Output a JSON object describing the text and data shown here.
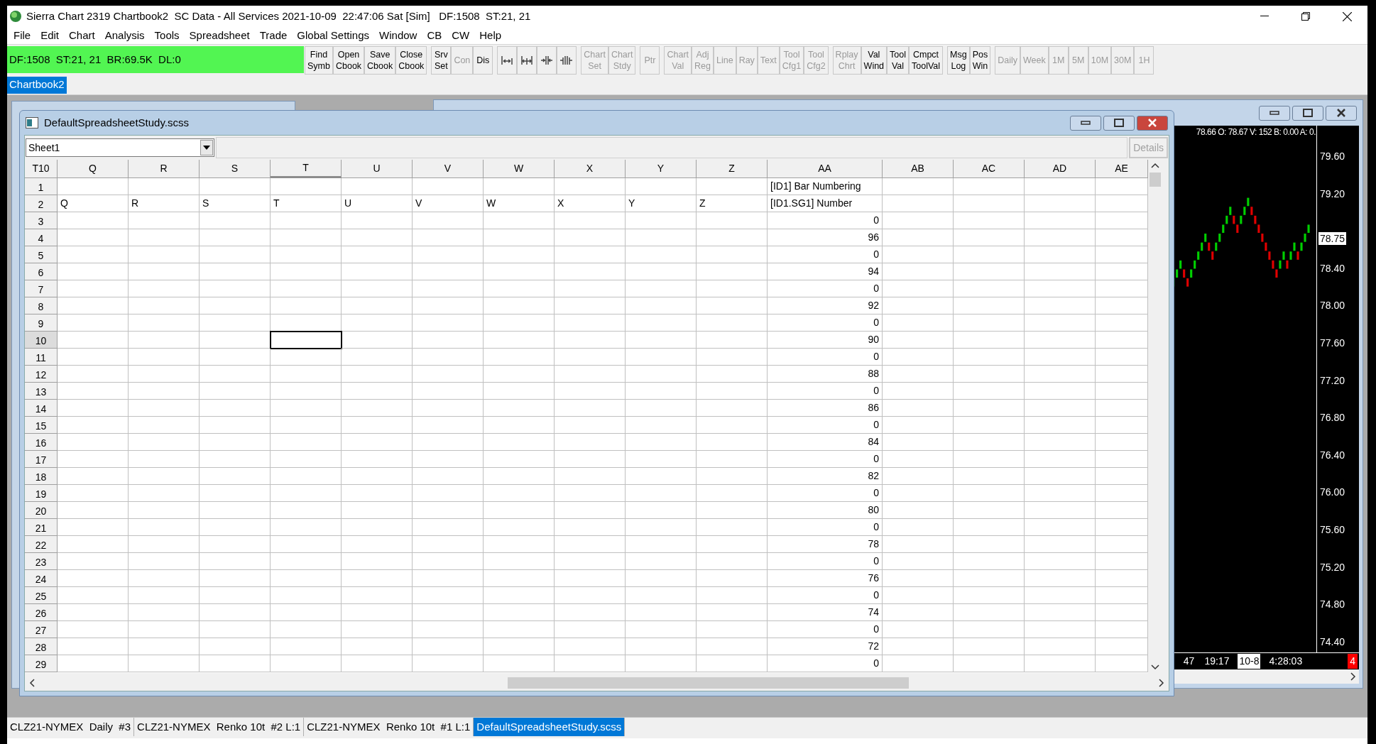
{
  "window": {
    "title": "Sierra Chart 2319 Chartbook2  SC Data - All Services 2021-10-09  22:47:06 Sat [Sim]   DF:1508  ST:21, 21"
  },
  "menu": [
    "File",
    "Edit",
    "Chart",
    "Analysis",
    "Tools",
    "Spreadsheet",
    "Trade",
    "Global Settings",
    "Window",
    "CB",
    "CW",
    "Help"
  ],
  "status_panel": "DF:1508  ST:21, 21  BR:69.5K  DL:0",
  "toolbar": [
    [
      {
        "kind": "text",
        "lines": [
          "Find",
          "Symb"
        ],
        "disabled": false
      },
      {
        "kind": "text",
        "lines": [
          "Open",
          "Cbook"
        ],
        "disabled": false
      },
      {
        "kind": "text",
        "lines": [
          "Save",
          "Cbook"
        ],
        "disabled": false
      },
      {
        "kind": "text",
        "lines": [
          "Close",
          "Cbook"
        ],
        "disabled": false
      }
    ],
    [
      {
        "kind": "text",
        "lines": [
          "Srv",
          "Set"
        ],
        "disabled": false
      },
      {
        "kind": "text",
        "lines": [
          "Con"
        ],
        "disabled": true
      },
      {
        "kind": "text",
        "lines": [
          "Dis"
        ],
        "disabled": false
      }
    ],
    [
      {
        "kind": "expand",
        "disabled": false
      },
      {
        "kind": "expandboth",
        "disabled": false
      },
      {
        "kind": "compress",
        "disabled": false
      },
      {
        "kind": "compressboth",
        "disabled": false
      }
    ],
    [
      {
        "kind": "text",
        "lines": [
          "Chart",
          "Set"
        ],
        "disabled": true
      },
      {
        "kind": "text",
        "lines": [
          "Chart",
          "Stdy"
        ],
        "disabled": true
      }
    ],
    [
      {
        "kind": "text",
        "lines": [
          "Ptr"
        ],
        "disabled": true
      }
    ],
    [
      {
        "kind": "text",
        "lines": [
          "Chart",
          "Val"
        ],
        "disabled": true
      },
      {
        "kind": "text",
        "lines": [
          "Adj",
          "Reg"
        ],
        "disabled": true
      },
      {
        "kind": "text",
        "lines": [
          "Line"
        ],
        "disabled": true
      },
      {
        "kind": "text",
        "lines": [
          "Ray"
        ],
        "disabled": true
      },
      {
        "kind": "text",
        "lines": [
          "Text"
        ],
        "disabled": true
      },
      {
        "kind": "text",
        "lines": [
          "Tool",
          "Cfg1"
        ],
        "disabled": true
      },
      {
        "kind": "text",
        "lines": [
          "Tool",
          "Cfg2"
        ],
        "disabled": true
      }
    ],
    [
      {
        "kind": "text",
        "lines": [
          "Rplay",
          "Chrt"
        ],
        "disabled": true
      },
      {
        "kind": "text",
        "lines": [
          "Val",
          "Wind"
        ],
        "disabled": false
      },
      {
        "kind": "text",
        "lines": [
          "Tool",
          "Val"
        ],
        "disabled": false
      },
      {
        "kind": "text",
        "lines": [
          "Cmpct",
          "ToolVal"
        ],
        "disabled": false
      }
    ],
    [
      {
        "kind": "text",
        "lines": [
          "Msg",
          "Log"
        ],
        "disabled": false
      },
      {
        "kind": "text",
        "lines": [
          "Pos",
          "Win"
        ],
        "disabled": false
      }
    ],
    [
      {
        "kind": "text",
        "lines": [
          "Daily"
        ],
        "disabled": true
      },
      {
        "kind": "text",
        "lines": [
          "Week"
        ],
        "disabled": true
      },
      {
        "kind": "text",
        "lines": [
          "1M"
        ],
        "disabled": true
      },
      {
        "kind": "text",
        "lines": [
          "5M"
        ],
        "disabled": true
      },
      {
        "kind": "text",
        "lines": [
          "10M"
        ],
        "disabled": true
      },
      {
        "kind": "text",
        "lines": [
          "30M"
        ],
        "disabled": true
      },
      {
        "kind": "text",
        "lines": [
          "1H"
        ],
        "disabled": true
      }
    ]
  ],
  "chartbook_tabs": [
    {
      "label": "Chartbook2",
      "selected": true
    }
  ],
  "chart_window": {
    "info": "78.66 O: 78.67 V: 152 B: 0.00 A: 0.",
    "price_axis": [
      "79.60",
      "79.20",
      "78.40",
      "78.00",
      "77.60",
      "77.20",
      "76.80",
      "76.40",
      "76.00",
      "75.60",
      "75.20",
      "74.80",
      "74.40"
    ],
    "current_price": "78.75",
    "time_axis": [
      {
        "label": "47",
        "kind": "plain"
      },
      {
        "label": "19:17",
        "kind": "plain"
      },
      {
        "label": "10-8",
        "kind": "highlight"
      },
      {
        "label": "4:28:03",
        "kind": "plain"
      }
    ],
    "badge": "4"
  },
  "spreadsheet": {
    "title": "DefaultSpreadsheetStudy.scss",
    "sheet": "Sheet1",
    "details_button": {
      "label": "Details",
      "disabled": true
    },
    "name_box": "T10",
    "columns": [
      {
        "label": "Q",
        "selected": false
      },
      {
        "label": "R",
        "selected": false
      },
      {
        "label": "S",
        "selected": false
      },
      {
        "label": "T",
        "selected": true
      },
      {
        "label": "U",
        "selected": false
      },
      {
        "label": "V",
        "selected": false
      },
      {
        "label": "W",
        "selected": false
      },
      {
        "label": "X",
        "selected": false
      },
      {
        "label": "Y",
        "selected": false
      },
      {
        "label": "Z",
        "selected": false
      },
      {
        "label": "AA",
        "selected": false
      },
      {
        "label": "AB",
        "selected": false
      },
      {
        "label": "AC",
        "selected": false
      },
      {
        "label": "AD",
        "selected": false
      },
      {
        "label": "AE",
        "selected": false
      }
    ],
    "rows": [
      {
        "header": "1",
        "selected": false,
        "kind": "text",
        "cells": [
          null,
          null,
          null,
          null,
          null,
          null,
          null,
          null,
          null,
          null,
          "[ID1] Bar Numbering",
          null,
          null,
          null,
          null
        ]
      },
      {
        "header": "2",
        "selected": false,
        "kind": "text",
        "cells": [
          "Q",
          "R",
          "S",
          "T",
          "U",
          "V",
          "W",
          "X",
          "Y",
          "Z",
          "[ID1.SG1] Number",
          null,
          null,
          null,
          null
        ]
      },
      {
        "header": "3",
        "selected": false,
        "kind": "number",
        "cells": [
          null,
          null,
          null,
          null,
          null,
          null,
          null,
          null,
          null,
          null,
          "0",
          null,
          null,
          null,
          null
        ]
      },
      {
        "header": "4",
        "selected": false,
        "kind": "number",
        "cells": [
          null,
          null,
          null,
          null,
          null,
          null,
          null,
          null,
          null,
          null,
          "96",
          null,
          null,
          null,
          null
        ]
      },
      {
        "header": "5",
        "selected": false,
        "kind": "number",
        "cells": [
          null,
          null,
          null,
          null,
          null,
          null,
          null,
          null,
          null,
          null,
          "0",
          null,
          null,
          null,
          null
        ]
      },
      {
        "header": "6",
        "selected": false,
        "kind": "number",
        "cells": [
          null,
          null,
          null,
          null,
          null,
          null,
          null,
          null,
          null,
          null,
          "94",
          null,
          null,
          null,
          null
        ]
      },
      {
        "header": "7",
        "selected": false,
        "kind": "number",
        "cells": [
          null,
          null,
          null,
          null,
          null,
          null,
          null,
          null,
          null,
          null,
          "0",
          null,
          null,
          null,
          null
        ]
      },
      {
        "header": "8",
        "selected": false,
        "kind": "number",
        "cells": [
          null,
          null,
          null,
          null,
          null,
          null,
          null,
          null,
          null,
          null,
          "92",
          null,
          null,
          null,
          null
        ]
      },
      {
        "header": "9",
        "selected": false,
        "kind": "number",
        "cells": [
          null,
          null,
          null,
          null,
          null,
          null,
          null,
          null,
          null,
          null,
          "0",
          null,
          null,
          null,
          null
        ]
      },
      {
        "header": "10",
        "selected": true,
        "kind": "number",
        "cells": [
          null,
          null,
          null,
          null,
          null,
          null,
          null,
          null,
          null,
          null,
          "90",
          null,
          null,
          null,
          null
        ]
      },
      {
        "header": "11",
        "selected": false,
        "kind": "number",
        "cells": [
          null,
          null,
          null,
          null,
          null,
          null,
          null,
          null,
          null,
          null,
          "0",
          null,
          null,
          null,
          null
        ]
      },
      {
        "header": "12",
        "selected": false,
        "kind": "number",
        "cells": [
          null,
          null,
          null,
          null,
          null,
          null,
          null,
          null,
          null,
          null,
          "88",
          null,
          null,
          null,
          null
        ]
      },
      {
        "header": "13",
        "selected": false,
        "kind": "number",
        "cells": [
          null,
          null,
          null,
          null,
          null,
          null,
          null,
          null,
          null,
          null,
          "0",
          null,
          null,
          null,
          null
        ]
      },
      {
        "header": "14",
        "selected": false,
        "kind": "number",
        "cells": [
          null,
          null,
          null,
          null,
          null,
          null,
          null,
          null,
          null,
          null,
          "86",
          null,
          null,
          null,
          null
        ]
      },
      {
        "header": "15",
        "selected": false,
        "kind": "number",
        "cells": [
          null,
          null,
          null,
          null,
          null,
          null,
          null,
          null,
          null,
          null,
          "0",
          null,
          null,
          null,
          null
        ]
      },
      {
        "header": "16",
        "selected": false,
        "kind": "number",
        "cells": [
          null,
          null,
          null,
          null,
          null,
          null,
          null,
          null,
          null,
          null,
          "84",
          null,
          null,
          null,
          null
        ]
      },
      {
        "header": "17",
        "selected": false,
        "kind": "number",
        "cells": [
          null,
          null,
          null,
          null,
          null,
          null,
          null,
          null,
          null,
          null,
          "0",
          null,
          null,
          null,
          null
        ]
      },
      {
        "header": "18",
        "selected": false,
        "kind": "number",
        "cells": [
          null,
          null,
          null,
          null,
          null,
          null,
          null,
          null,
          null,
          null,
          "82",
          null,
          null,
          null,
          null
        ]
      },
      {
        "header": "19",
        "selected": false,
        "kind": "number",
        "cells": [
          null,
          null,
          null,
          null,
          null,
          null,
          null,
          null,
          null,
          null,
          "0",
          null,
          null,
          null,
          null
        ]
      },
      {
        "header": "20",
        "selected": false,
        "kind": "number",
        "cells": [
          null,
          null,
          null,
          null,
          null,
          null,
          null,
          null,
          null,
          null,
          "80",
          null,
          null,
          null,
          null
        ]
      },
      {
        "header": "21",
        "selected": false,
        "kind": "number",
        "cells": [
          null,
          null,
          null,
          null,
          null,
          null,
          null,
          null,
          null,
          null,
          "0",
          null,
          null,
          null,
          null
        ]
      },
      {
        "header": "22",
        "selected": false,
        "kind": "number",
        "cells": [
          null,
          null,
          null,
          null,
          null,
          null,
          null,
          null,
          null,
          null,
          "78",
          null,
          null,
          null,
          null
        ]
      },
      {
        "header": "23",
        "selected": false,
        "kind": "number",
        "cells": [
          null,
          null,
          null,
          null,
          null,
          null,
          null,
          null,
          null,
          null,
          "0",
          null,
          null,
          null,
          null
        ]
      },
      {
        "header": "24",
        "selected": false,
        "kind": "number",
        "cells": [
          null,
          null,
          null,
          null,
          null,
          null,
          null,
          null,
          null,
          null,
          "76",
          null,
          null,
          null,
          null
        ]
      },
      {
        "header": "25",
        "selected": false,
        "kind": "number",
        "cells": [
          null,
          null,
          null,
          null,
          null,
          null,
          null,
          null,
          null,
          null,
          "0",
          null,
          null,
          null,
          null
        ]
      },
      {
        "header": "26",
        "selected": false,
        "kind": "number",
        "cells": [
          null,
          null,
          null,
          null,
          null,
          null,
          null,
          null,
          null,
          null,
          "74",
          null,
          null,
          null,
          null
        ]
      },
      {
        "header": "27",
        "selected": false,
        "kind": "number",
        "cells": [
          null,
          null,
          null,
          null,
          null,
          null,
          null,
          null,
          null,
          null,
          "0",
          null,
          null,
          null,
          null
        ]
      },
      {
        "header": "28",
        "selected": false,
        "kind": "number",
        "cells": [
          null,
          null,
          null,
          null,
          null,
          null,
          null,
          null,
          null,
          null,
          "72",
          null,
          null,
          null,
          null
        ]
      },
      {
        "header": "29",
        "selected": false,
        "kind": "number",
        "cells": [
          null,
          null,
          null,
          null,
          null,
          null,
          null,
          null,
          null,
          null,
          "0",
          null,
          null,
          null,
          null
        ]
      }
    ]
  },
  "bottom_tabs": [
    {
      "label": "CLZ21-NYMEX  Daily  #3",
      "selected": false
    },
    {
      "label": "CLZ21-NYMEX  Renko 10t  #2 L:1",
      "selected": false
    },
    {
      "label": "CLZ21-NYMEX  Renko 10t  #1 L:1",
      "selected": false
    },
    {
      "label": "DefaultSpreadsheetStudy.scss",
      "selected": true
    }
  ]
}
